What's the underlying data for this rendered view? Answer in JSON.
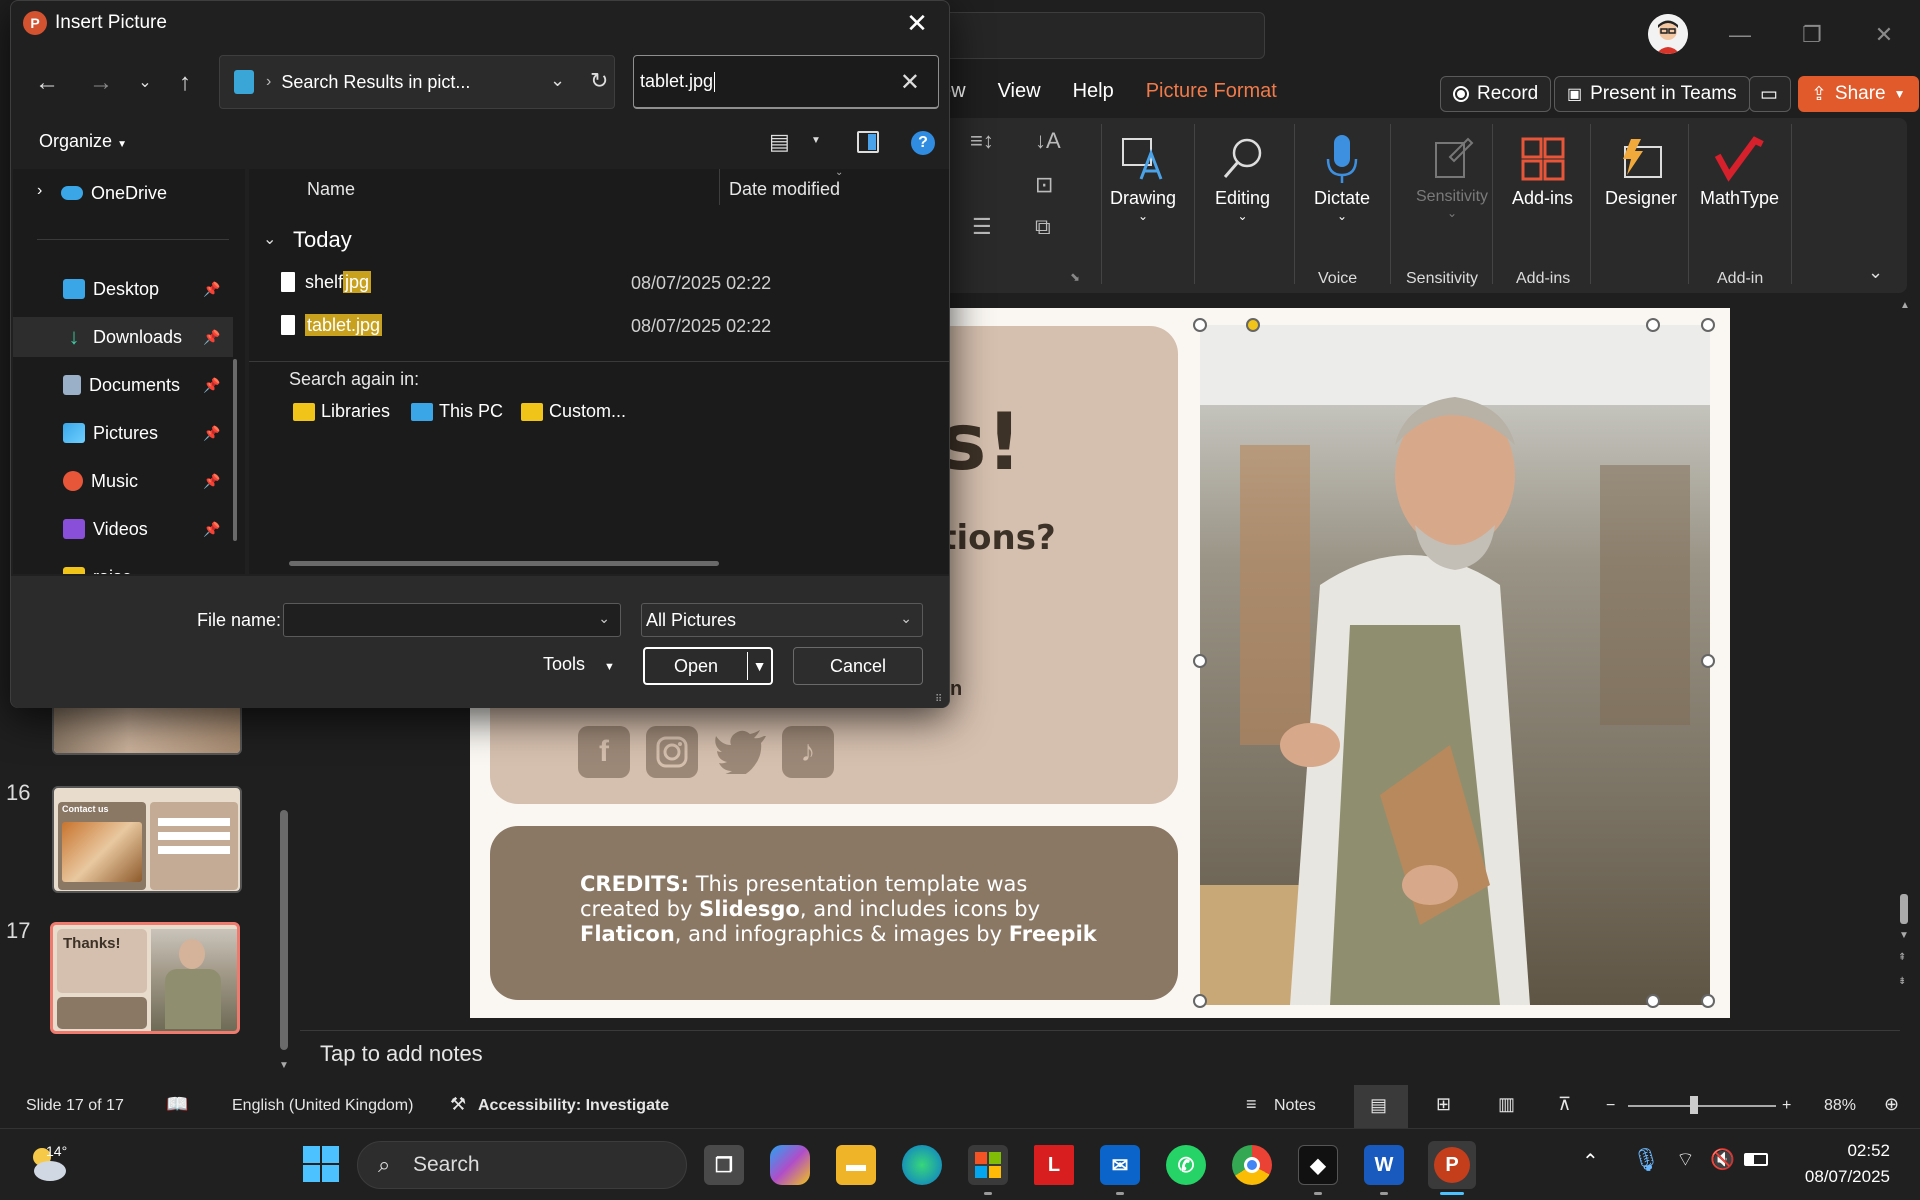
{
  "dialog": {
    "title": "Insert Picture",
    "address": "Search Results in pict...",
    "search_value": "tablet.jpg",
    "organize": "Organize",
    "columns": {
      "name": "Name",
      "date": "Date modified"
    },
    "group": "Today",
    "files": [
      {
        "name_plain": "shelf",
        "name_hl": "jpg",
        "date": "08/07/2025 02:22"
      },
      {
        "name_plain": "",
        "name_hl": "tablet.jpg",
        "date": "08/07/2025 02:22"
      }
    ],
    "search_again_label": "Search again in:",
    "search_again": [
      "Libraries",
      "This PC",
      "Custom..."
    ],
    "nav": [
      "OneDrive",
      "Desktop",
      "Downloads",
      "Documents",
      "Pictures",
      "Music",
      "Videos",
      "raise"
    ],
    "file_name_label": "File name:",
    "file_name_value": "",
    "file_type": "All Pictures",
    "tools": "Tools",
    "open": "Open",
    "cancel": "Cancel"
  },
  "ppt": {
    "tabs": [
      "ew",
      "View",
      "Help",
      "Picture Format"
    ],
    "record": "Record",
    "present_teams": "Present in Teams",
    "share": "Share",
    "ribbon": {
      "drawing": "Drawing",
      "editing": "Editing",
      "dictate": "Dictate",
      "sensitivity": "Sensitivity",
      "addins": "Add-ins",
      "designer": "Designer",
      "mathtype": "MathType",
      "group_voice": "Voice",
      "group_sensitivity": "Sensitivity",
      "group_addins": "Add-ins",
      "group_addin": "Add-in"
    },
    "slide": {
      "big": "s!",
      "sub": "stions?",
      "small": "n",
      "credits_label": "CREDITS:",
      "credits_1": " This presentation template was created by ",
      "credits_slidesgo": "Slidesgo",
      "credits_2": ", and includes icons by ",
      "credits_flaticon": "Flaticon",
      "credits_3": ", and infographics & images by ",
      "credits_freepik": "Freepik"
    },
    "thumb_numbers": [
      "16",
      "17"
    ],
    "thumb17_title": "Thanks!",
    "thumb16_title": "Contact us",
    "notes_placeholder": "Tap to add notes",
    "status": {
      "slide": "Slide 17 of 17",
      "language": "English (United Kingdom)",
      "accessibility": "Accessibility: Investigate",
      "notes": "Notes",
      "zoom": "88%"
    }
  },
  "taskbar": {
    "weather": "14°",
    "search": "Search",
    "time": "02:52",
    "date": "08/07/2025"
  }
}
